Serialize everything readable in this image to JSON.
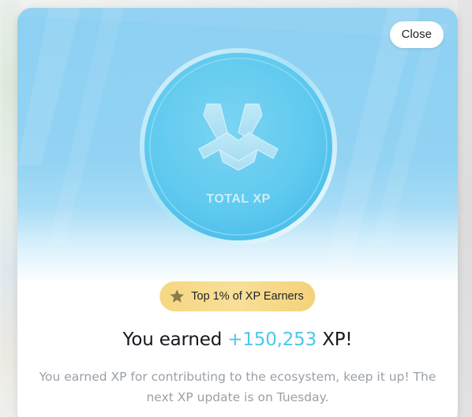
{
  "modal": {
    "close_label": "Close",
    "coin": {
      "label": "TOTAL XP",
      "icon": "xp-logo-icon",
      "color": "#5ec9ef"
    },
    "badge": {
      "icon": "star-icon",
      "label": "Top 1% of XP Earners",
      "color": "#f5d783"
    },
    "headline": {
      "prefix": "You earned",
      "amount": "+150,253",
      "suffix": "XP!",
      "amount_color": "#4cc6ef"
    },
    "description": "You earned XP for contributing to the ecosystem, keep it up! The next XP update is on Tuesday."
  }
}
